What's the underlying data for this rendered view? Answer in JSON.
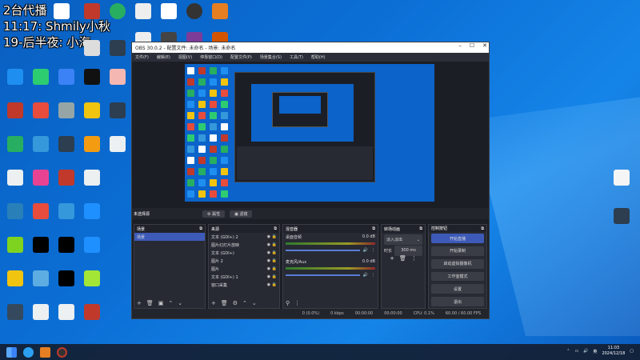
{
  "overlay": {
    "line1": "2台代播",
    "line2": "11:17: Shmily小秋",
    "line3": "19-后半夜: 小海"
  },
  "desktop_icons_left": [
    {
      "label": "",
      "color": "#ffffff",
      "col": 0,
      "row": 0
    },
    {
      "label": "",
      "color": "#c0392b",
      "col": 1,
      "row": 0
    },
    {
      "label": "",
      "color": "#27ae60",
      "col": 2,
      "row": 0
    },
    {
      "label": "",
      "color": "#eeeeee",
      "col": 3,
      "row": 0
    },
    {
      "label": "",
      "color": "#ffffff",
      "col": 4,
      "row": 0
    },
    {
      "label": "",
      "color": "#333333",
      "col": 5,
      "row": 0
    },
    {
      "label": "",
      "color": "#e67e22",
      "col": 6,
      "row": 0
    },
    {
      "label": "",
      "color": "#eeeeee",
      "col": 3,
      "row": 1
    },
    {
      "label": "",
      "color": "#444444",
      "col": 4,
      "row": 1
    },
    {
      "label": "",
      "color": "#7d3c98",
      "col": 5,
      "row": 1
    },
    {
      "label": "",
      "color": "#d35400",
      "col": 6,
      "row": 1
    }
  ],
  "desktop_grid": [
    [
      "#1f8ef1",
      "#2ecc71",
      "#3b82f6",
      "#111111",
      "#f5b7b1"
    ],
    [
      "#c0392b",
      "#e74c3c",
      "#95a5a6",
      "#f1c40f",
      "#2c3e50"
    ],
    [
      "#27ae60",
      "#3498db",
      "#2c3e50",
      "#f39c12",
      "#ecf0f1"
    ],
    [
      "#ecf0f1",
      "#e84393",
      "#c0392b",
      "#ecf0f1",
      ""
    ],
    [
      "#2980b9",
      "#e74c3c",
      "#3498db",
      "#1e90ff",
      ""
    ],
    [
      "#7ed321",
      "#000000",
      "#000000",
      "#1e90ff",
      ""
    ],
    [
      "#f1c40f",
      "#5dade2",
      "#000000",
      "#a3e635",
      ""
    ],
    [
      "#34495e",
      "#ecf0f1",
      "#ecf0f1",
      "#c0392b",
      ""
    ]
  ],
  "desktop_right": [
    {
      "label": "",
      "color": "#f5f5f5"
    },
    {
      "label": "",
      "color": "#2c3e50"
    }
  ],
  "obs": {
    "title": "OBS 30.0.2 - 配置文件: 未命名 - 场景: 未命名",
    "menu": [
      "文件(F)",
      "编辑(E)",
      "视图(V)",
      "停靠窗口(D)",
      "配置文件(P)",
      "场景集合(S)",
      "工具(T)",
      "帮助(H)"
    ],
    "scene_bar": {
      "label": "未选择源",
      "props_btn": "⚙ 属性",
      "filters_btn": "▣ 滤镜"
    },
    "docks": {
      "scenes": {
        "title": "场景",
        "items": [
          "场景"
        ]
      },
      "sources": {
        "title": "来源",
        "items": [
          "文本 (GDI+) 2",
          "图片幻灯片放映",
          "文本 (GDI+)",
          "图片 2",
          "图片",
          "文本 (GDI+) 1",
          "窗口采集"
        ]
      },
      "mixer": {
        "title": "混音器",
        "channels": [
          {
            "name": "桌面音频",
            "db": "0.0 dB"
          },
          {
            "name": "麦克风/Aux",
            "db": "0.0 dB"
          }
        ]
      },
      "transitions": {
        "title": "转场动画",
        "mode": "淡入淡出",
        "duration_label": "时长",
        "duration": "300 ms"
      },
      "controls": {
        "title": "控制按钮",
        "buttons": [
          "开始直播",
          "开始录制",
          "启动虚拟摄像机",
          "工作室模式",
          "设置",
          "退出"
        ]
      }
    },
    "status": {
      "dropped": "0 (0.0%)",
      "bitrate": "0 kbps",
      "rec": "00:00:00",
      "stream": "00:00:00",
      "cpu": "CPU: 0.1%",
      "fps": "60.00 / 60.00 FPS"
    }
  },
  "taskbar": {
    "time": "11:03",
    "date": "2024/12/18",
    "lang": "英"
  }
}
